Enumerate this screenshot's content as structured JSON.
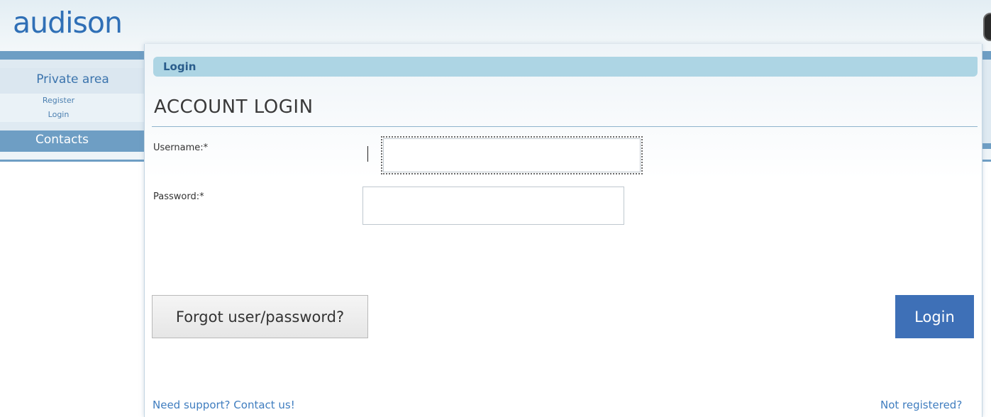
{
  "brand": {
    "logo_text": "audison"
  },
  "sidebar": {
    "items": [
      {
        "label": "Private area"
      },
      {
        "label": "Register"
      },
      {
        "label": "Login"
      },
      {
        "label": "Contacts"
      }
    ]
  },
  "breadcrumb": {
    "label": "Login"
  },
  "form": {
    "title": "ACCOUNT LOGIN",
    "username_label": "Username:*",
    "username_value": "",
    "password_label": "Password:*",
    "password_value": "",
    "forgot_label": "Forgot user/password?",
    "login_label": "Login"
  },
  "footer": {
    "support_link": "Need support? Contact us!",
    "register_link": "Not registered?"
  },
  "colors": {
    "brand_blue": "#2f6fb6",
    "nav_band": "#6e9ec4",
    "breadcrumb_bg": "#add5e4",
    "login_button": "#3e70b7",
    "link": "#3f7dbf"
  }
}
